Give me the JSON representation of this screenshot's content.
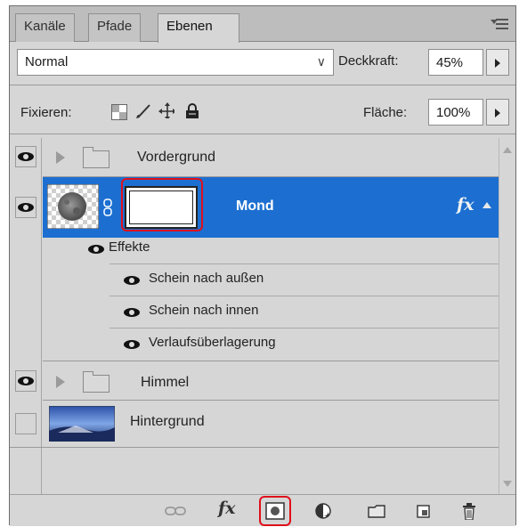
{
  "tabs": [
    "Kanäle",
    "Pfade",
    "Ebenen"
  ],
  "active_tab": "Ebenen",
  "blend_mode": "Normal",
  "opacity": {
    "label": "Deckkraft:",
    "value": "45%"
  },
  "lock": {
    "label": "Fixieren:",
    "icons": [
      "lock-transparent-pixels-icon",
      "lock-image-pixels-icon",
      "lock-position-icon",
      "lock-all-icon"
    ]
  },
  "fill": {
    "label": "Fläche:",
    "value": "100%"
  },
  "layers": [
    {
      "name": "Vordergrund",
      "type": "group",
      "visible": true,
      "expanded": false
    },
    {
      "name": "Mond",
      "type": "layer",
      "visible": true,
      "selected": true,
      "has_mask": true,
      "has_effects": true,
      "fx_label": "fx"
    },
    {
      "name": "Himmel",
      "type": "group",
      "visible": true,
      "expanded": false
    },
    {
      "name": "Hintergrund",
      "type": "layer",
      "visible": false
    }
  ],
  "effects": {
    "header": "Effekte",
    "items": [
      "Schein nach außen",
      "Schein nach innen",
      "Verlaufsüberlagerung"
    ]
  },
  "bottom_icons": [
    "link-layers-icon",
    "fx-icon",
    "add-mask-icon",
    "adjustment-layer-icon",
    "new-group-icon",
    "new-layer-icon",
    "delete-layer-icon"
  ],
  "bottom_fx_label": "fx",
  "colors": {
    "selection": "#1c6fd1",
    "highlight": "#e0101b",
    "panel": "#d6d6d6"
  }
}
